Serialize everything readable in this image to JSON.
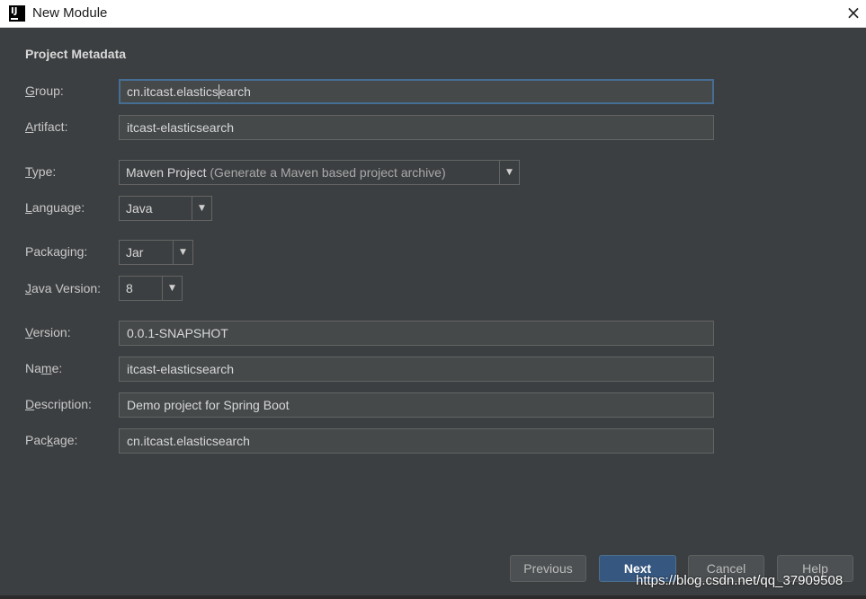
{
  "window": {
    "title": "New Module",
    "app_icon_text": "IJ"
  },
  "section": {
    "title": "Project Metadata"
  },
  "fields": {
    "group": {
      "label_mnemonic": "G",
      "label_rest": "roup:",
      "value_before_caret": "cn.itcast.elastics",
      "value_after_caret": "earch"
    },
    "artifact": {
      "label_mnemonic": "A",
      "label_rest": "rtifact:",
      "value": "itcast-elasticsearch"
    },
    "type": {
      "label_mnemonic": "T",
      "label_rest": "ype:",
      "value": "Maven Project",
      "hint": "(Generate a Maven based project archive)"
    },
    "language": {
      "label_mnemonic": "L",
      "label_rest": "anguage:",
      "value": "Java"
    },
    "packaging": {
      "label_pre": "Packa",
      "label_mnemonic": "g",
      "label_rest": "ing:",
      "value": "Jar"
    },
    "java_version": {
      "label_mnemonic": "J",
      "label_rest": "ava Version:",
      "value": "8"
    },
    "version": {
      "label_mnemonic": "V",
      "label_rest": "ersion:",
      "value": "0.0.1-SNAPSHOT"
    },
    "name": {
      "label_pre": "Na",
      "label_mnemonic": "m",
      "label_rest": "e:",
      "value": "itcast-elasticsearch"
    },
    "description": {
      "label_mnemonic": "D",
      "label_rest": "escription:",
      "value": "Demo project for Spring Boot"
    },
    "package": {
      "label_pre": "Pac",
      "label_mnemonic": "k",
      "label_rest": "age:",
      "value": "cn.itcast.elasticsearch"
    }
  },
  "buttons": {
    "previous": "Previous",
    "next": "Next",
    "cancel": "Cancel",
    "help": "Help"
  },
  "watermark": "https://blog.csdn.net/qq_37909508",
  "icons": {
    "close": "×",
    "dropdown": "▼"
  }
}
